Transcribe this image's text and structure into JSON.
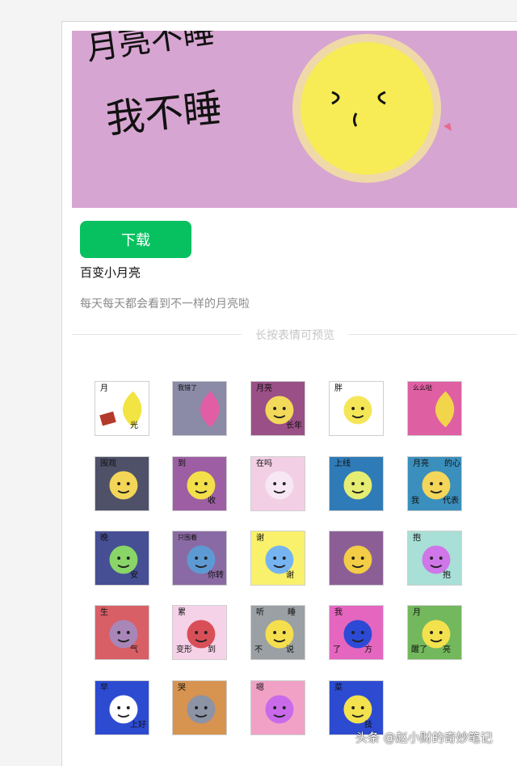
{
  "banner": {
    "line1": "月亮不睡",
    "line2": "我不睡",
    "bg": "#d7a5d1",
    "moon": "#f7ec55"
  },
  "actions": {
    "download_label": "下载"
  },
  "pack": {
    "title": "百变小月亮",
    "description": "每天每天都会看到不一样的月亮啦"
  },
  "preview_hint": "长按表情可预览",
  "stickers": [
    {
      "bg": "#ffffff",
      "moon": "#f2e442",
      "texts": [
        "月",
        "光"
      ]
    },
    {
      "bg": "#8b8aa7",
      "moon": "#e25ea4",
      "texts": [
        "我错了"
      ]
    },
    {
      "bg": "#9a4f86",
      "moon": "#f3d95a",
      "texts": [
        "月亮",
        "长年"
      ]
    },
    {
      "bg": "#ffffff",
      "moon": "#f5e657",
      "texts": [
        "胖"
      ]
    },
    {
      "bg": "#df5fa3",
      "moon": "#f2d54b",
      "texts": [
        "么么哒"
      ]
    },
    {
      "bg": "#4f5169",
      "moon": "#f3d657",
      "texts": [
        "围观"
      ]
    },
    {
      "bg": "#9d5ea3",
      "moon": "#f2df4a",
      "texts": [
        "到",
        "收"
      ]
    },
    {
      "bg": "#f2cfe5",
      "moon": "#f7e7f4",
      "texts": [
        "在吗"
      ]
    },
    {
      "bg": "#2f7bb7",
      "moon": "#e5ed72",
      "texts": [
        "上线"
      ]
    },
    {
      "bg": "#3b8fbc",
      "moon": "#f3d65a",
      "texts": [
        "月亮",
        "代表",
        "我",
        "的心"
      ]
    },
    {
      "bg": "#464f93",
      "moon": "#89d568",
      "texts": [
        "晚",
        "安"
      ]
    },
    {
      "bg": "#8a6aa4",
      "moon": "#5d9ad4",
      "texts": [
        "只围着",
        "你转"
      ]
    },
    {
      "bg": "#f9f16b",
      "moon": "#75b4f0",
      "texts": [
        "谢",
        "谢"
      ]
    },
    {
      "bg": "#8b5f95",
      "moon": "#f2cd45",
      "texts": []
    },
    {
      "bg": "#a8dfd6",
      "moon": "#cf76e8",
      "texts": [
        "抱",
        "抱"
      ]
    },
    {
      "bg": "#d85f66",
      "moon": "#a886b8",
      "texts": [
        "生",
        "气"
      ]
    },
    {
      "bg": "#f6d2e8",
      "moon": "#d94f58",
      "texts": [
        "累",
        "到",
        "变形"
      ]
    },
    {
      "bg": "#9ba0a4",
      "moon": "#f5df4e",
      "texts": [
        "听",
        "说",
        "不",
        "睡"
      ]
    },
    {
      "bg": "#e566bf",
      "moon": "#2d4ad6",
      "texts": [
        "我",
        "方",
        "了"
      ]
    },
    {
      "bg": "#73b85d",
      "moon": "#f3e24d",
      "texts": [
        "月",
        "亮",
        "醒了"
      ]
    },
    {
      "bg": "#2d4bd1",
      "moon": "#ffffff",
      "texts": [
        "早",
        "上好"
      ]
    },
    {
      "bg": "#d79350",
      "moon": "#8c93a5",
      "texts": [
        "哭"
      ]
    },
    {
      "bg": "#f1a1c6",
      "moon": "#c86ae9",
      "texts": [
        "嗯"
      ]
    },
    {
      "bg": "#2d4bd1",
      "moon": "#f3e24d",
      "texts": [
        "菜",
        "技"
      ]
    }
  ],
  "watermark": "头条 @赵小财的奇妙笔记"
}
